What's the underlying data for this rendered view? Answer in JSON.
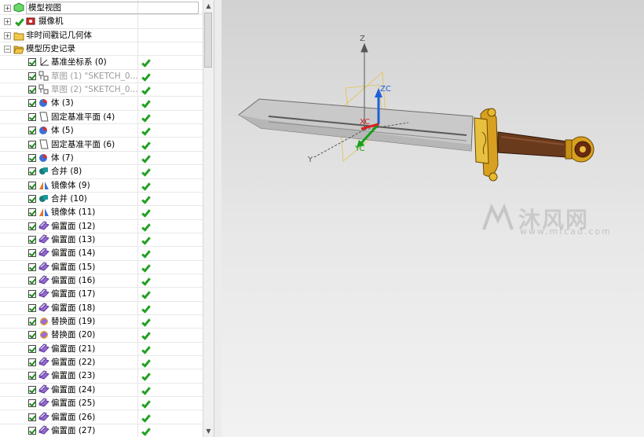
{
  "tree": {
    "root": {
      "label": "模型视图"
    },
    "camera": {
      "label": "摄像机"
    },
    "unused_geom": {
      "label": "非时间戳记几何体"
    },
    "history": {
      "label": "模型历史记录"
    },
    "features": [
      {
        "label": "基准坐标系 (0)",
        "dim": false
      },
      {
        "label": "草图 (1) \"SKETCH_0...",
        "dim": true
      },
      {
        "label": "草图 (2) \"SKETCH_0...",
        "dim": true
      },
      {
        "label": "体 (3)",
        "dim": false
      },
      {
        "label": "固定基准平面 (4)",
        "dim": false
      },
      {
        "label": "体 (5)",
        "dim": false
      },
      {
        "label": "固定基准平面 (6)",
        "dim": false
      },
      {
        "label": "体 (7)",
        "dim": false
      },
      {
        "label": "合并 (8)",
        "dim": false
      },
      {
        "label": "镜像体 (9)",
        "dim": false
      },
      {
        "label": "合并 (10)",
        "dim": false
      },
      {
        "label": "镜像体 (11)",
        "dim": false
      },
      {
        "label": "偏置面 (12)",
        "dim": false
      },
      {
        "label": "偏置面 (13)",
        "dim": false
      },
      {
        "label": "偏置面 (14)",
        "dim": false
      },
      {
        "label": "偏置面 (15)",
        "dim": false
      },
      {
        "label": "偏置面 (16)",
        "dim": false
      },
      {
        "label": "偏置面 (17)",
        "dim": false
      },
      {
        "label": "偏置面 (18)",
        "dim": false
      },
      {
        "label": "替换面 (19)",
        "dim": false
      },
      {
        "label": "替换面 (20)",
        "dim": false
      },
      {
        "label": "偏置面 (21)",
        "dim": false
      },
      {
        "label": "偏置面 (22)",
        "dim": false
      },
      {
        "label": "偏置面 (23)",
        "dim": false
      },
      {
        "label": "偏置面 (24)",
        "dim": false
      },
      {
        "label": "偏置面 (25)",
        "dim": false
      },
      {
        "label": "偏置面 (26)",
        "dim": false
      },
      {
        "label": "偏置面 (27)",
        "dim": false
      }
    ],
    "feature_icons": [
      "csys-icon",
      "sketch-icon",
      "sketch-icon",
      "body-icon",
      "datum-plane-icon",
      "body-icon",
      "datum-plane-icon",
      "body-icon",
      "unite-icon",
      "mirror-body-icon",
      "unite-icon",
      "mirror-body-icon",
      "offset-face-icon",
      "offset-face-icon",
      "offset-face-icon",
      "offset-face-icon",
      "offset-face-icon",
      "offset-face-icon",
      "offset-face-icon",
      "replace-face-icon",
      "replace-face-icon",
      "offset-face-icon",
      "offset-face-icon",
      "offset-face-icon",
      "offset-face-icon",
      "offset-face-icon",
      "offset-face-icon",
      "offset-face-icon"
    ]
  },
  "viewport": {
    "axes": {
      "z": "Z",
      "y": "Y",
      "zc": "ZC",
      "yc": "YC",
      "xc": "XC"
    },
    "watermark": {
      "text": "沐风网",
      "url": "www.mfcad.com"
    }
  },
  "colors": {
    "check_green": "#22a022",
    "folder_yellow": "#f2c94c",
    "zc_blue": "#1e5fd8",
    "yc_green": "#18a018",
    "xc_red": "#d82020",
    "guard_gold": "#d8a020",
    "grip_brown": "#6a3a1c"
  }
}
